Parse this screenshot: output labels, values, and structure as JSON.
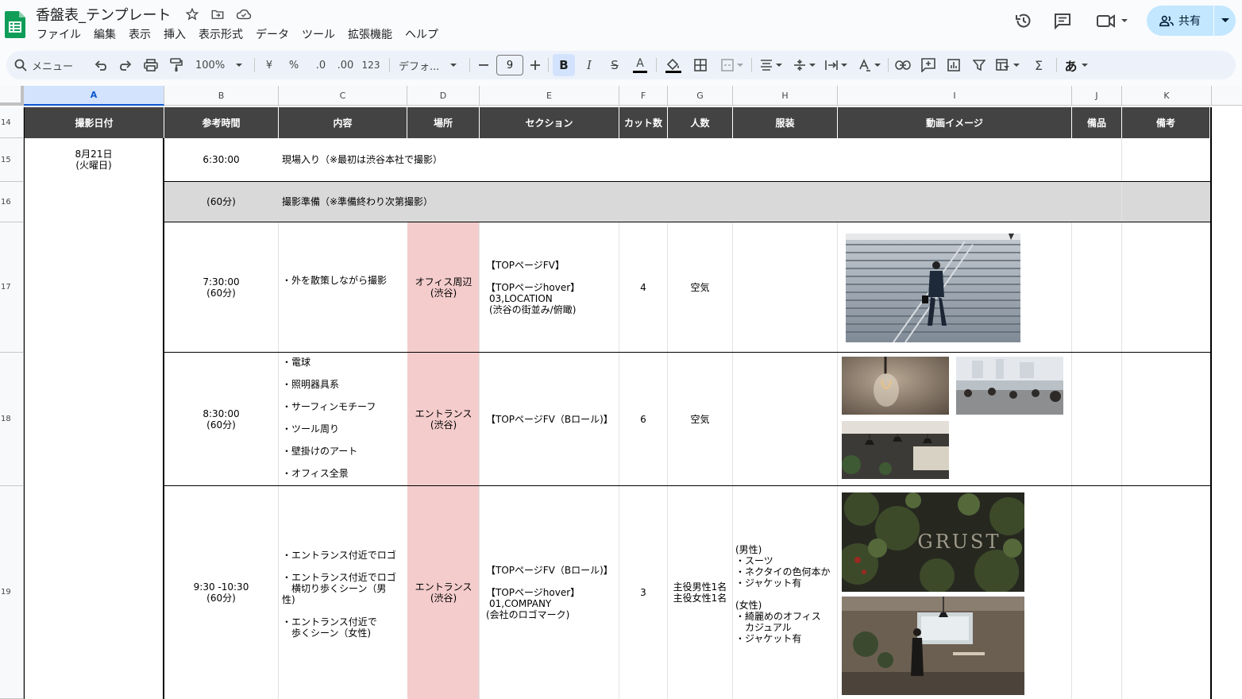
{
  "doc": {
    "title": "香盤表_テンプレート"
  },
  "menu": [
    "ファイル",
    "編集",
    "表示",
    "挿入",
    "表示形式",
    "データ",
    "ツール",
    "拡張機能",
    "ヘルプ"
  ],
  "share": {
    "label": "共有"
  },
  "toolbar": {
    "search_label": "メニュー",
    "zoom": "100%",
    "currency": "¥",
    "percent": "%",
    "dec_decrease": ".0",
    "dec_increase": ".00",
    "number_format": "123",
    "font": "デフォ...",
    "font_size": "9",
    "bold": "B",
    "italic": "I",
    "strike": "S",
    "text_color": "A",
    "input_tools": "あ"
  },
  "columns": [
    "A",
    "B",
    "C",
    "D",
    "E",
    "F",
    "G",
    "H",
    "I",
    "J",
    "K"
  ],
  "rows": [
    "14",
    "15",
    "16",
    "17",
    "18",
    "19"
  ],
  "headers": [
    "撮影日付",
    "参考時間",
    "内容",
    "場所",
    "セクション",
    "カット数",
    "人数",
    "服装",
    "動画イメージ",
    "備品",
    "備考"
  ],
  "date": {
    "line1": "8月21日",
    "line2": "(火曜日)"
  },
  "r15": {
    "time": "6:30:00",
    "content": "現場入り（※最初は渋谷本社で撮影）"
  },
  "r16": {
    "time": "(60分)",
    "content": "撮影準備（※準備終わり次第撮影）"
  },
  "r17": {
    "time1": "7:30:00",
    "time2": "(60分)",
    "content": "・外を散策しながら撮影",
    "place1": "オフィス周辺",
    "place2": "(渋谷)",
    "section": [
      "【TOPページFV】",
      "",
      "【TOPページhover】",
      " 03,LOCATION",
      " (渋谷の街並み/俯瞰)"
    ],
    "cuts": "4",
    "people": "空気"
  },
  "r18": {
    "time1": "8:30:00",
    "time2": "(60分)",
    "content": [
      "・電球",
      "・照明器具系",
      "・サーフィンモチーフ",
      "・ツール周り",
      "・壁掛けのアート",
      "・オフィス全景"
    ],
    "place1": "エントランス",
    "place2": "(渋谷)",
    "section": "【TOPページFV（Bロール)】",
    "cuts": "6",
    "people": "空気"
  },
  "r19": {
    "time1": "9:30 -10:30",
    "time2": "(60分)",
    "content": [
      "・エントランス付近でロゴ",
      "",
      "・エントランス付近でロゴ",
      "　横切り歩くシーン（男",
      "性)",
      "",
      "・エントランス付近で",
      "　歩くシーン（女性)"
    ],
    "place1": "エントランス",
    "place2": "(渋谷)",
    "section": [
      "【TOPページFV（Bロール)】",
      "",
      "【TOPページhover】",
      " 01,COMPANY",
      " (会社のロゴマーク)"
    ],
    "cuts": "3",
    "people": [
      "主役男性1名",
      "主役女性1名"
    ],
    "costume": [
      "(男性)",
      "・スーツ",
      "・ネクタイの色何本か",
      "・ジャケット有",
      "",
      "(女性)",
      "・綺麗めのオフィス",
      "　カジュアル",
      "・ジャケット有"
    ],
    "sign_text": "GRUST"
  },
  "colors": {
    "header_bg": "#434343",
    "pink": "#f4cccc",
    "gray": "#d9d9d9",
    "share_bg": "#c2e7ff",
    "toolbar_bg": "#edf2fa",
    "sheets_green": "#0f9d58"
  }
}
